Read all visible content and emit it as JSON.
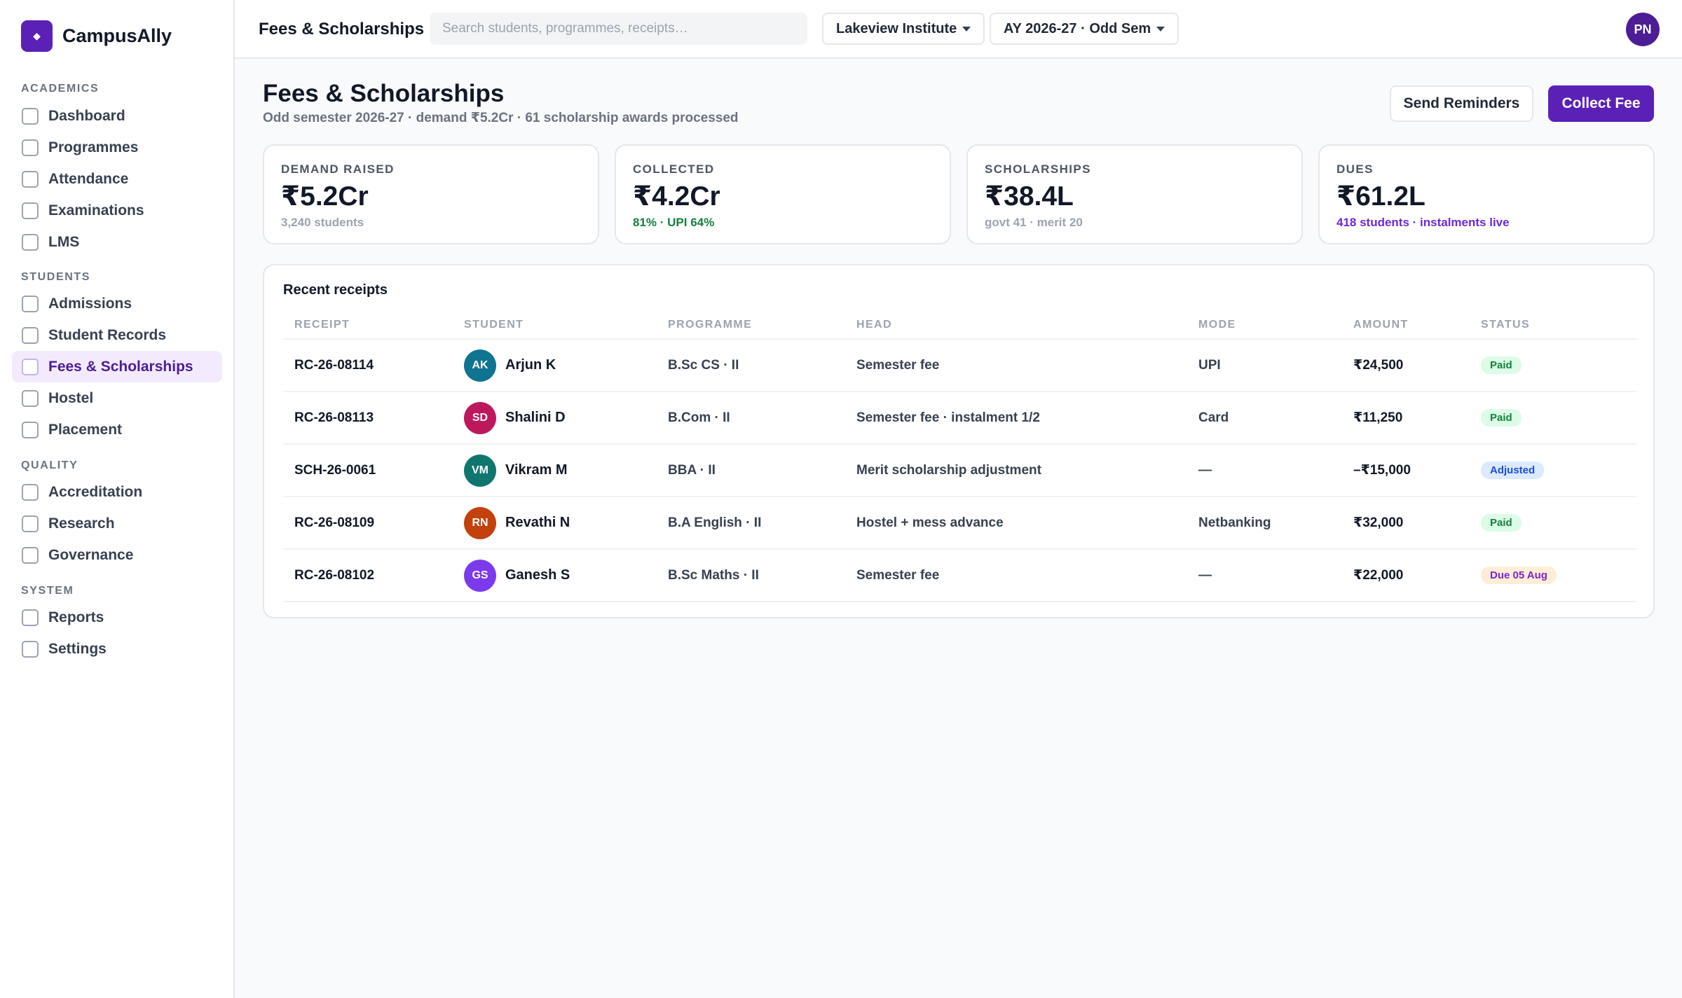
{
  "app": {
    "name": "CampusAlly"
  },
  "sidebar": {
    "sections": [
      {
        "title": "ACADEMICS",
        "items": [
          "Dashboard",
          "Programmes",
          "Attendance",
          "Examinations",
          "LMS"
        ]
      },
      {
        "title": "STUDENTS",
        "items": [
          "Admissions",
          "Student Records",
          "Fees & Scholarships",
          "Hostel",
          "Placement"
        ]
      },
      {
        "title": "QUALITY",
        "items": [
          "Accreditation",
          "Research",
          "Governance"
        ]
      },
      {
        "title": "SYSTEM",
        "items": [
          "Reports",
          "Settings"
        ]
      }
    ],
    "active_item": "Fees & Scholarships"
  },
  "topbar": {
    "title": "Fees & Scholarships",
    "search_placeholder": "Search students, programmes, receipts…",
    "institute": "Lakeview Institute",
    "term": "AY 2026-27 · Odd Sem",
    "user_initials": "PN"
  },
  "page": {
    "title": "Fees & Scholarships",
    "subtitle": "Odd semester 2026-27 · demand ₹5.2Cr · 61 scholarship awards processed",
    "send_reminders_label": "Send Reminders",
    "collect_fee_label": "Collect Fee"
  },
  "stats": [
    {
      "label": "DEMAND RAISED",
      "value": "₹5.2Cr",
      "sub": "3,240 students",
      "sub_color": "#9ca3af"
    },
    {
      "label": "COLLECTED",
      "value": "₹4.2Cr",
      "sub": "81% · UPI 64%",
      "sub_color": "#15803d"
    },
    {
      "label": "SCHOLARSHIPS",
      "value": "₹38.4L",
      "sub": "govt 41 · merit 20",
      "sub_color": "#9ca3af"
    },
    {
      "label": "DUES",
      "value": "₹61.2L",
      "sub": "418 students · instalments live",
      "sub_color": "#6d28d9"
    }
  ],
  "receipts": {
    "title": "Recent receipts",
    "columns": [
      "RECEIPT",
      "STUDENT",
      "PROGRAMME",
      "HEAD",
      "MODE",
      "AMOUNT",
      "STATUS"
    ],
    "rows": [
      {
        "receipt": "RC-26-08114",
        "initials": "AK",
        "avatar_color": "#0e7490",
        "student": "Arjun K",
        "programme": "B.Sc CS · II",
        "head": "Semester fee",
        "mode": "UPI",
        "amount": "₹24,500",
        "status": "Paid",
        "status_bg": "#dcfce7",
        "status_fg": "#15803d"
      },
      {
        "receipt": "RC-26-08113",
        "initials": "SD",
        "avatar_color": "#be185d",
        "student": "Shalini D",
        "programme": "B.Com · II",
        "head": "Semester fee · instalment 1/2",
        "mode": "Card",
        "amount": "₹11,250",
        "status": "Paid",
        "status_bg": "#dcfce7",
        "status_fg": "#15803d"
      },
      {
        "receipt": "SCH-26-0061",
        "initials": "VM",
        "avatar_color": "#0f766e",
        "student": "Vikram M",
        "programme": "BBA · II",
        "head": "Merit scholarship adjustment",
        "mode": "—",
        "amount": "–₹15,000",
        "status": "Adjusted",
        "status_bg": "#dbeafe",
        "status_fg": "#1d4ed8"
      },
      {
        "receipt": "RC-26-08109",
        "initials": "RN",
        "avatar_color": "#c2410c",
        "student": "Revathi N",
        "programme": "B.A English · II",
        "head": "Hostel + mess advance",
        "mode": "Netbanking",
        "amount": "₹32,000",
        "status": "Paid",
        "status_bg": "#dcfce7",
        "status_fg": "#15803d"
      },
      {
        "receipt": "RC-26-08102",
        "initials": "GS",
        "avatar_color": "#7c3aed",
        "student": "Ganesh S",
        "programme": "B.Sc Maths · II",
        "head": "Semester fee",
        "mode": "—",
        "amount": "₹22,000",
        "status": "Due 05 Aug",
        "status_bg": "#ffedd5",
        "status_fg": "#7e22ce"
      }
    ]
  }
}
